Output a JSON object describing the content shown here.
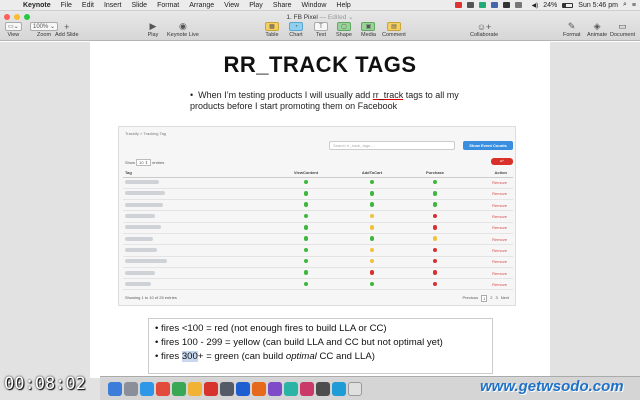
{
  "menubar": {
    "app": "Keynote",
    "items": [
      "File",
      "Edit",
      "Insert",
      "Slide",
      "Format",
      "Arrange",
      "View",
      "Play",
      "Share",
      "Window",
      "Help"
    ],
    "battery": "24%",
    "clock": "Sun 5:46 pm"
  },
  "window": {
    "title": "1. FB Pixel",
    "edited": "— Edited ⌄"
  },
  "toolbar": {
    "view": "View",
    "zoom": "Zoom",
    "zoom_value": "100% ⌄",
    "add_slide": "Add Slide",
    "play": "Play",
    "keynote_live": "Keynote Live",
    "table": "Table",
    "chart": "Chart",
    "text": "Text",
    "shape": "Shape",
    "media": "Media",
    "comment": "Comment",
    "collaborate": "Collaborate",
    "format": "Format",
    "animate": "Animate",
    "document": "Document"
  },
  "slide": {
    "title": "RR_TRACK TAGS",
    "bullet_pre": "When I’m testing products I will usually add ",
    "bullet_underlined": "rr_track",
    "bullet_post": " tags to all my products before I start promoting them on Facebook"
  },
  "embedded": {
    "breadcrumb": "Trackify > Tracking Tag",
    "search_placeholder": "Search rr_track_tags ...",
    "events_button": "Show Event Counts",
    "show_label": "Show",
    "show_value": "10 ⇕",
    "entries_label": "entries",
    "columns": [
      "Tag",
      "ViewContent",
      "AddToCart",
      "Purchase",
      "Action"
    ],
    "rows": [
      {
        "vc": "#3cb83c",
        "atc": "#3cb83c",
        "pur": "#3cb83c",
        "action": "Remove"
      },
      {
        "vc": "#3cb83c",
        "atc": "#3cb83c",
        "pur": "#3cb83c",
        "action": "Remove"
      },
      {
        "vc": "#3cb83c",
        "atc": "#3cb83c",
        "pur": "#3cb83c",
        "action": "Remove"
      },
      {
        "vc": "#3cb83c",
        "atc": "#f0c23a",
        "pur": "#d83030",
        "action": "Remove"
      },
      {
        "vc": "#3cb83c",
        "atc": "#f0c23a",
        "pur": "#d83030",
        "action": "Remove"
      },
      {
        "vc": "#3cb83c",
        "atc": "#3cb83c",
        "pur": "#f0c23a",
        "action": "Remove"
      },
      {
        "vc": "#3cb83c",
        "atc": "#f0c23a",
        "pur": "#d83030",
        "action": "Remove"
      },
      {
        "vc": "#3cb83c",
        "atc": "#f0c23a",
        "pur": "#d83030",
        "action": "Remove"
      },
      {
        "vc": "#3cb83c",
        "atc": "#d83030",
        "pur": "#d83030",
        "action": "Remove"
      },
      {
        "vc": "#3cb83c",
        "atc": "#3cb83c",
        "pur": "#d83030",
        "action": "Remove"
      }
    ],
    "footer": "Showing 1 to 10 of 25 entries",
    "pager": [
      "Previous",
      "1",
      "2",
      "3",
      "Next"
    ]
  },
  "notes": {
    "line1": "fires <100  = red (not enough fires to build LLA or CC)",
    "line2": "fires 100 - 299 = yellow (can build LLA and CC but not optimal yet)",
    "line3_pre": "fires ",
    "line3_highlight": "300",
    "line3_mid": "+ = green (can build ",
    "line3_italic": "optimal",
    "line3_post": " CC and LLA)"
  },
  "overlay": {
    "timer": "00:08:02",
    "watermark": "www.getwsodo.com"
  }
}
